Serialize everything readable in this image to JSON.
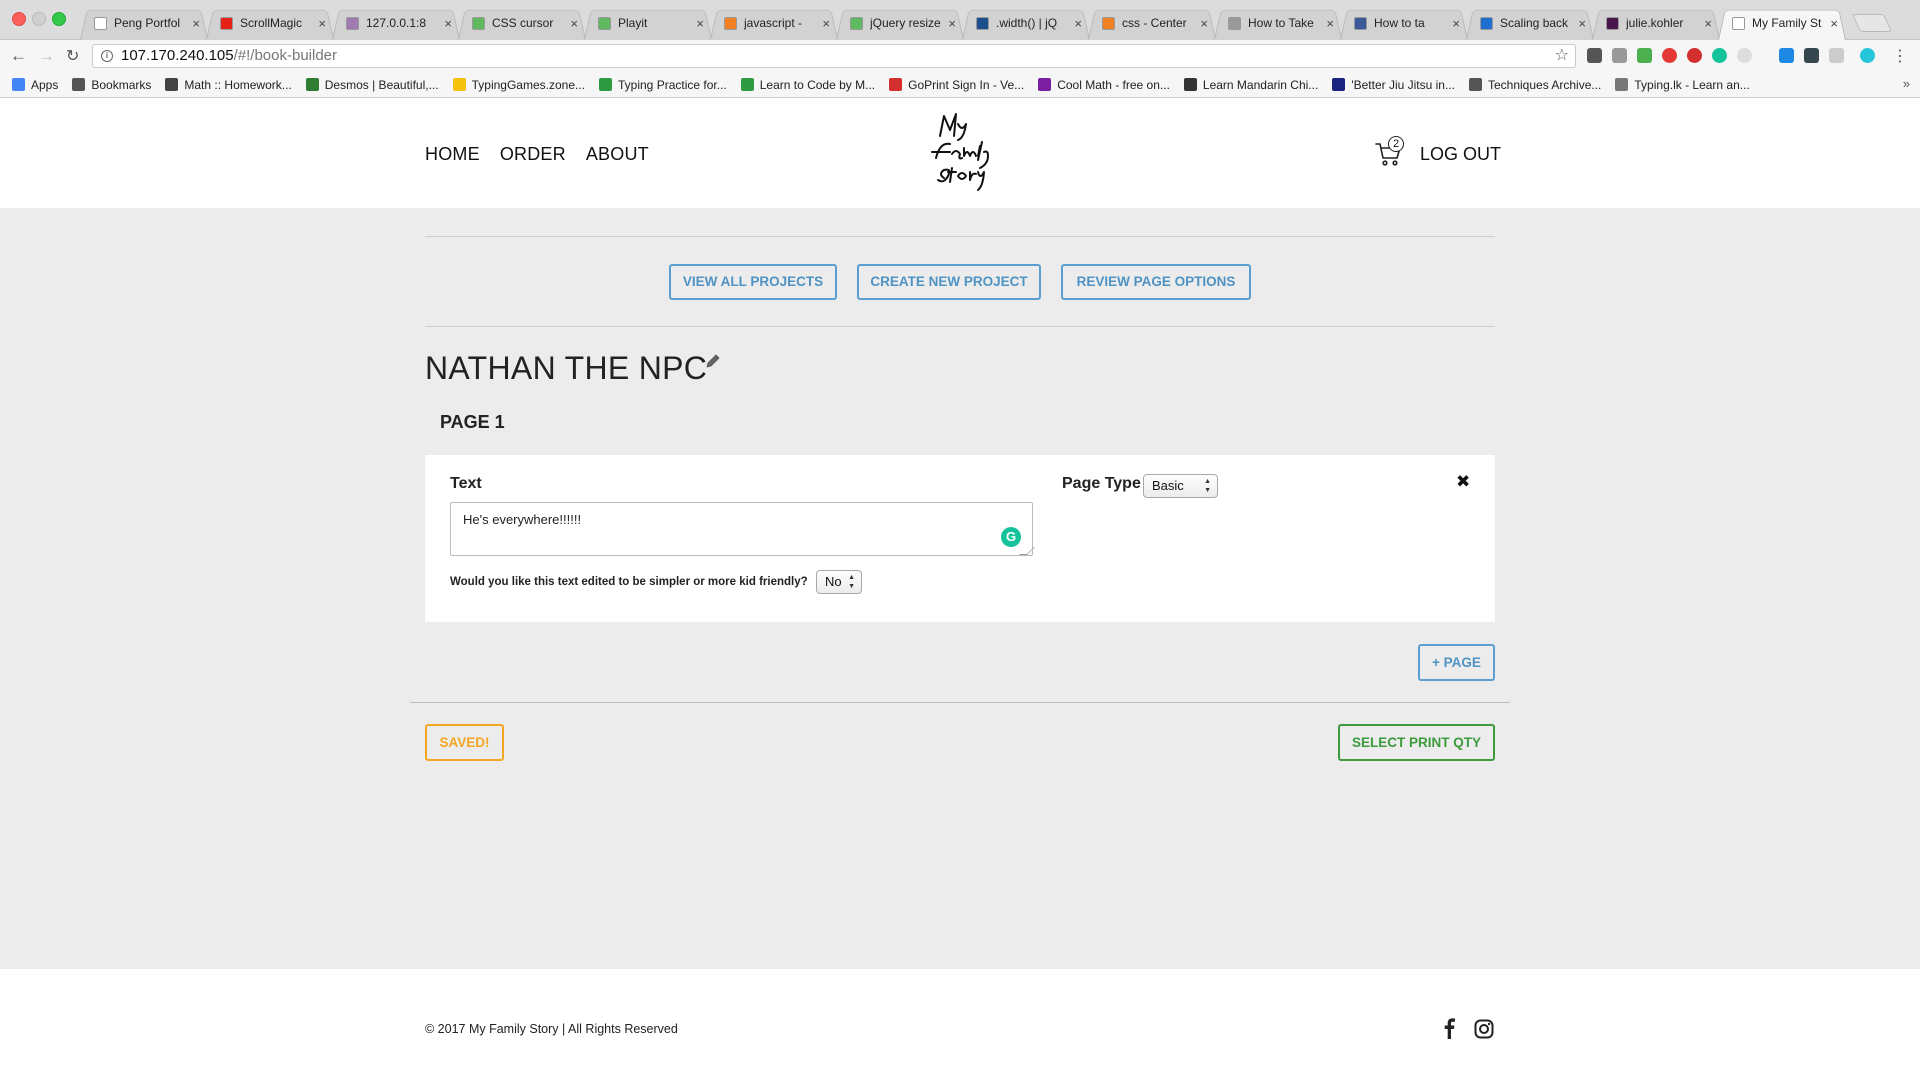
{
  "browser": {
    "tabs": [
      {
        "title": "Peng Portfol",
        "fav_color": "#ffffff"
      },
      {
        "title": "ScrollMagic",
        "fav_color": "#e62117"
      },
      {
        "title": "127.0.0.1:8",
        "fav_color": "#a07ab0"
      },
      {
        "title": "CSS cursor",
        "fav_color": "#5fb95f"
      },
      {
        "title": "Playit",
        "fav_color": "#5fb95f"
      },
      {
        "title": "javascript -",
        "fav_color": "#f48024"
      },
      {
        "title": "jQuery resize",
        "fav_color": "#5fb95f"
      },
      {
        "title": ".width() | jQ",
        "fav_color": "#1c4f8c"
      },
      {
        "title": "css - Center",
        "fav_color": "#f48024"
      },
      {
        "title": "How to Take",
        "fav_color": "#999999"
      },
      {
        "title": "How to ta",
        "fav_color": "#3b5998"
      },
      {
        "title": "Scaling back",
        "fav_color": "#1e6fd0"
      },
      {
        "title": "julie.kohler",
        "fav_color": "#4a154b"
      },
      {
        "title": "My Family St",
        "fav_color": "#ffffff"
      }
    ],
    "url_host": "107.170.240.105",
    "url_path": "/#!/book-builder",
    "bookmarks": [
      {
        "label": "Apps",
        "color": "#4285f4"
      },
      {
        "label": "Bookmarks",
        "color": "#555555"
      },
      {
        "label": "Math :: Homework...",
        "color": "#444444"
      },
      {
        "label": "Desmos | Beautiful,...",
        "color": "#2e7d32"
      },
      {
        "label": "TypingGames.zone...",
        "color": "#f4c20d"
      },
      {
        "label": "Typing Practice for...",
        "color": "#2e9a42"
      },
      {
        "label": "Learn to Code by M...",
        "color": "#2e9a42"
      },
      {
        "label": "GoPrint Sign In - Ve...",
        "color": "#d32f2f"
      },
      {
        "label": "Cool Math - free on...",
        "color": "#7b1fa2"
      },
      {
        "label": "Learn Mandarin Chi...",
        "color": "#333333"
      },
      {
        "label": "'Better Jiu Jitsu in...",
        "color": "#1a237e"
      },
      {
        "label": "Techniques Archive...",
        "color": "#555555"
      },
      {
        "label": "Typing.lk - Learn an...",
        "color": "#777777"
      }
    ]
  },
  "header": {
    "nav": [
      "HOME",
      "ORDER",
      "ABOUT"
    ],
    "cart_count": "2",
    "logout": "LOG OUT",
    "logo_alt": "My Family Story"
  },
  "actions": {
    "view_all": "VIEW ALL PROJECTS",
    "create_new": "CREATE NEW PROJECT",
    "review_options": "REVIEW PAGE OPTIONS"
  },
  "project": {
    "title": "NATHAN THE NPC",
    "page_label": "PAGE 1",
    "text_label": "Text",
    "text_value": "He's everywhere!!!!!!",
    "edit_question": "Would you like this text edited to be simpler or more kid friendly?",
    "edit_answer": "No",
    "page_type_label": "Page Type",
    "page_type_value": "Basic"
  },
  "buttons": {
    "add_page": "+ PAGE",
    "saved": "SAVED!",
    "select_print": "SELECT PRINT QTY"
  },
  "footer": {
    "copyright": "© 2017 My Family Story | All Rights Reserved"
  },
  "colors": {
    "accent_blue": "#4f93c4",
    "saved_orange": "#f5a623",
    "print_green": "#3d9a3d",
    "background": "#ececec"
  }
}
